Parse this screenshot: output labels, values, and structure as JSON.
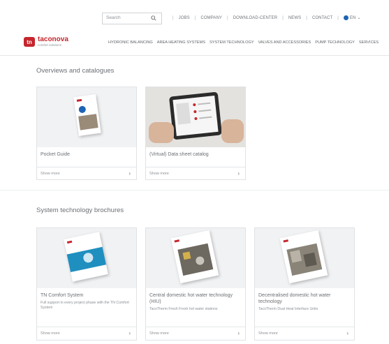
{
  "topbar": {
    "search_placeholder": "Search",
    "links": [
      "JOBS",
      "COMPANY",
      "DOWNLOAD-CENTER",
      "NEWS",
      "CONTACT"
    ],
    "language": "EN"
  },
  "header": {
    "logo_name": "taconova",
    "logo_sub": "comfort solutions",
    "nav": [
      "HYDRONIC BALANCING",
      "AREA HEATING SYSTEMS",
      "SYSTEM TECHNOLOGY",
      "VALVES AND ACCESSORIES",
      "PUMP TECHNOLOGY",
      "SERVICES"
    ]
  },
  "sections": [
    {
      "title": "Overviews and catalogues",
      "cards": [
        {
          "title": "Pocket Guide",
          "desc": "",
          "more": "Show more"
        },
        {
          "title": "(Virtual) Data sheet catalog",
          "desc": "",
          "more": "Show more"
        }
      ]
    },
    {
      "title": "System technology brochures",
      "cards": [
        {
          "title": "TN Comfort System",
          "desc": "Full support in every project phase with the TN Comfort System",
          "more": "Show more"
        },
        {
          "title": "Central domestic hot water technology (HIU)",
          "desc": "TacoTherm Fresh Fresh hot water stations",
          "more": "Show more"
        },
        {
          "title": "Decentralised domestic hot water technology",
          "desc": "TacoTherm Dual Heat Interface Units",
          "more": "Show more"
        }
      ]
    }
  ],
  "colors": {
    "brand": "#c5262c",
    "accent": "#1d63b6"
  }
}
